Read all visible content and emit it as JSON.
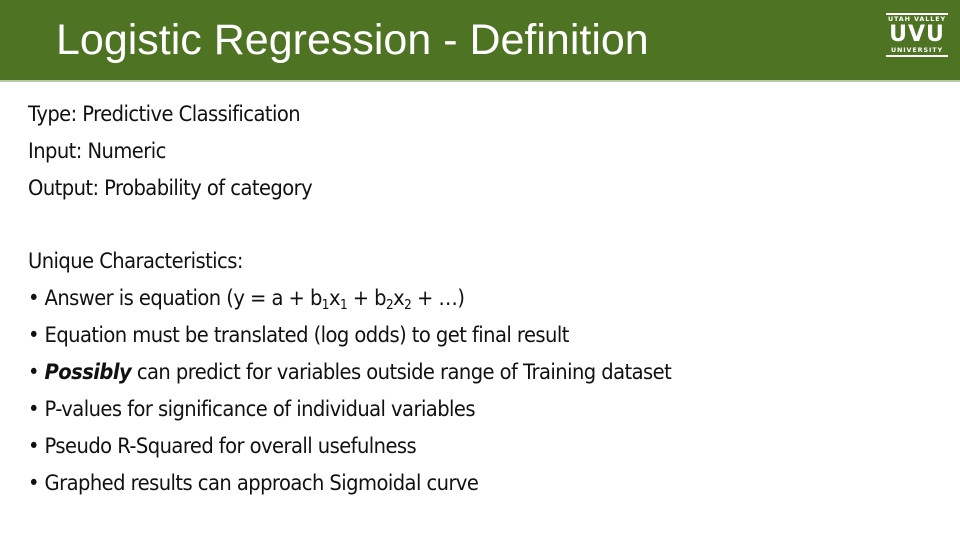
{
  "header": {
    "title": "Logistic Regression - Definition",
    "background_color": "#4e7322",
    "logo": {
      "top_text": "UTAH VALLEY",
      "main_text": "UVU",
      "bottom_text": "UNIVERSITY"
    }
  },
  "definition": {
    "type": "Type: Predictive Classification",
    "input": "Input:  Numeric",
    "output": "Output:  Probability of category"
  },
  "characteristics": {
    "heading": "Unique Characteristics:",
    "bullet_symbol": "•",
    "equation": {
      "prefix": "Answer is equation  (y = a + b",
      "sub1": "1",
      "x1": "x",
      "sub2": "1",
      "plus": " + b",
      "sub3": "2",
      "x2": "x",
      "sub4": "2",
      "suffix": " + …)"
    },
    "items": [
      "Equation must be translated (log odds) to get final result",
      "can predict for variables outside range of Training dataset",
      "P-values for significance of individual variables",
      "Pseudo R-Squared for overall usefulness",
      "Graphed results can approach Sigmoidal curve"
    ],
    "emphasis_word": "Possibly"
  }
}
